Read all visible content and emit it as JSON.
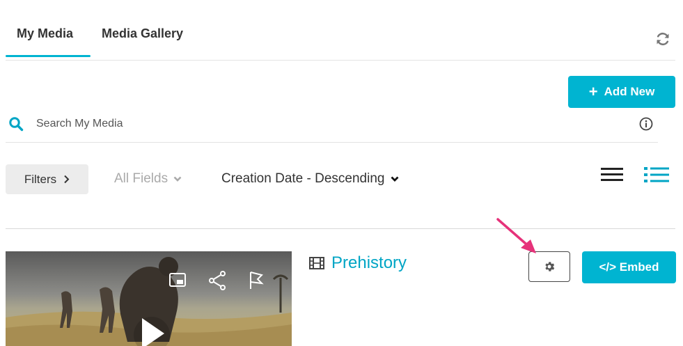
{
  "tabs": [
    {
      "label": "My Media",
      "active": true
    },
    {
      "label": "Media Gallery",
      "active": false
    }
  ],
  "toolbar": {
    "add_new_label": "Add New"
  },
  "search": {
    "placeholder": "Search My Media",
    "value": ""
  },
  "filters": {
    "filters_label": "Filters",
    "fields_label": "All Fields",
    "sort_label": "Creation Date - Descending"
  },
  "media": [
    {
      "title": "Prehistory",
      "embed_label": "</> Embed"
    }
  ],
  "colors": {
    "accent": "#00b4d1",
    "title": "#00a5c5",
    "arrow": "#e6327a"
  }
}
